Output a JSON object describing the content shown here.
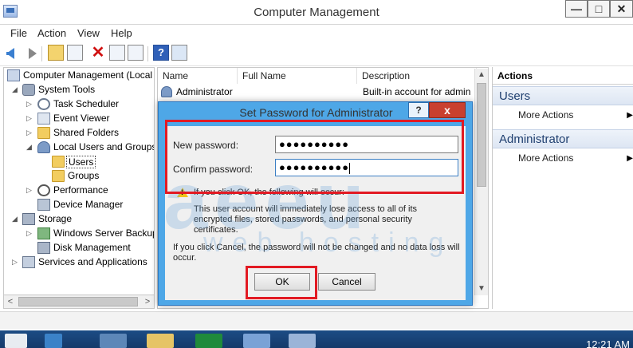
{
  "window": {
    "title": "Computer Management",
    "min_label": "—",
    "max_label": "□",
    "close_label": "✕"
  },
  "menu": [
    "File",
    "Action",
    "View",
    "Help"
  ],
  "tree": {
    "root": "Computer Management (Local",
    "system_tools": "System Tools",
    "task_scheduler": "Task Scheduler",
    "event_viewer": "Event Viewer",
    "shared_folders": "Shared Folders",
    "local_users": "Local Users and Groups",
    "users": "Users",
    "groups": "Groups",
    "performance": "Performance",
    "device_manager": "Device Manager",
    "storage": "Storage",
    "wsb": "Windows Server Backup",
    "disk_management": "Disk Management",
    "services": "Services and Applications"
  },
  "list": {
    "columns": [
      "Name",
      "Full Name",
      "Description"
    ],
    "rows": [
      {
        "name": "Administrator",
        "full_name": "",
        "description": "Built-in account for admin"
      }
    ]
  },
  "actions": {
    "header": "Actions",
    "groups": [
      {
        "title": "Users",
        "item": "More Actions"
      },
      {
        "title": "Administrator",
        "item": "More Actions"
      }
    ]
  },
  "dialog": {
    "title": "Set Password for Administrator",
    "help_label": "?",
    "close_label": "x",
    "new_password_label": "New password:",
    "new_password_value": "●●●●●●●●●●",
    "confirm_password_label": "Confirm password:",
    "confirm_password_value": "●●●●●●●●●●",
    "warning_heading": "If you click OK, the following will occur:",
    "warning_body": "This user account will immediately lose access to all of its encrypted files, stored passwords, and personal security certificates.",
    "cancel_note": "If you click Cancel, the password will not be changed and no data loss will occur.",
    "ok_label": "OK",
    "cancel_label": "Cancel"
  },
  "watermark": {
    "main": "aeeu",
    "sub": "web hosting"
  },
  "taskbar": {
    "clock": "12:21 AM"
  },
  "colors": {
    "dialog_frame": "#4ea7e7",
    "highlight": "#e21a23",
    "actions_group": "#dde6f3",
    "taskbar": "#1c4c85"
  }
}
